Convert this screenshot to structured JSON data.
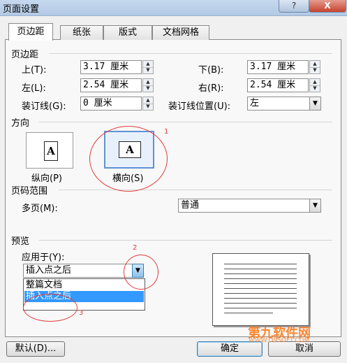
{
  "window": {
    "title": "页面设置",
    "help_symbol": "?",
    "close_symbol": "X"
  },
  "tabs": [
    {
      "label": "页边距",
      "active": true
    },
    {
      "label": "纸张",
      "active": false
    },
    {
      "label": "版式",
      "active": false
    },
    {
      "label": "文档网格",
      "active": false
    }
  ],
  "margins": {
    "heading": "页边距",
    "top_label": "上(T):",
    "top_value": "3.17 厘米",
    "bottom_label": "下(B):",
    "bottom_value": "3.17 厘米",
    "left_label": "左(L):",
    "left_value": "2.54 厘米",
    "right_label": "右(R):",
    "right_value": "2.54 厘米",
    "gutter_label": "装订线(G):",
    "gutter_value": "0 厘米",
    "gutter_pos_label": "装订线位置(U):",
    "gutter_pos_value": "左"
  },
  "orientation": {
    "heading": "方向",
    "portrait_label": "纵向(P)",
    "landscape_label": "横向(S)",
    "icon_letter": "A",
    "selected": "landscape"
  },
  "pages": {
    "heading": "页码范围",
    "multiple_label": "多页(M):",
    "multiple_value": "普通"
  },
  "preview": {
    "heading": "预览",
    "apply_label": "应用于(Y):",
    "apply_value": "插入点之后",
    "options": [
      "整篇文档",
      "插入点之后"
    ],
    "highlighted_option": "插入点之后"
  },
  "buttons": {
    "default": "默认(D)...",
    "ok": "确定",
    "cancel": "取消"
  },
  "annotations": {
    "n1": "1",
    "n2": "2",
    "n3": "3"
  },
  "watermark": {
    "text": "第九软件网",
    "sub": "WWW.D9SOFT.COM"
  },
  "colors": {
    "accent": "#3399ff",
    "annotation": "#e23b3b",
    "watermark": "#ff7a1a"
  }
}
